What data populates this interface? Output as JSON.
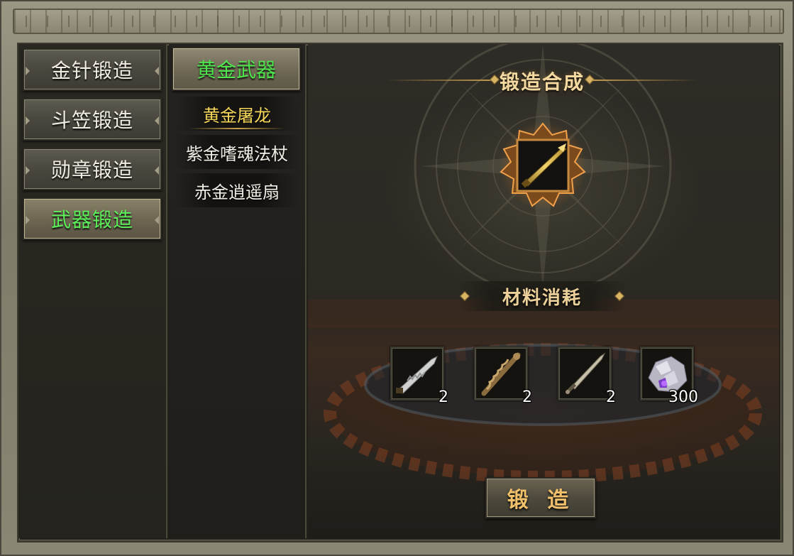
{
  "left_tabs": [
    {
      "label": "金针锻造",
      "active": false
    },
    {
      "label": "斗笠锻造",
      "active": false
    },
    {
      "label": "勋章锻造",
      "active": false
    },
    {
      "label": "武器锻造",
      "active": true
    }
  ],
  "sub_header": "黄金武器",
  "sub_items": [
    {
      "label": "黄金屠龙",
      "selected": true
    },
    {
      "label": "紫金嗜魂法杖",
      "selected": false
    },
    {
      "label": "赤金逍遥扇",
      "selected": false
    }
  ],
  "panel": {
    "title": "锻造合成",
    "target_icon": "golden-dragon-sword-icon",
    "materials_label": "材料消耗",
    "materials": [
      {
        "icon": "serrated-blade-icon",
        "count": "2"
      },
      {
        "icon": "twisted-staff-icon",
        "count": "2"
      },
      {
        "icon": "short-sword-icon",
        "count": "2"
      },
      {
        "icon": "purple-crystal-ore-icon",
        "count": "300"
      }
    ],
    "forge_button": "锻 造"
  },
  "colors": {
    "active_tab_text": "#5cf05a",
    "selected_item_text": "#f6d75a",
    "title_gold": "#f3d9a0",
    "forge_text": "#f0c06a"
  }
}
